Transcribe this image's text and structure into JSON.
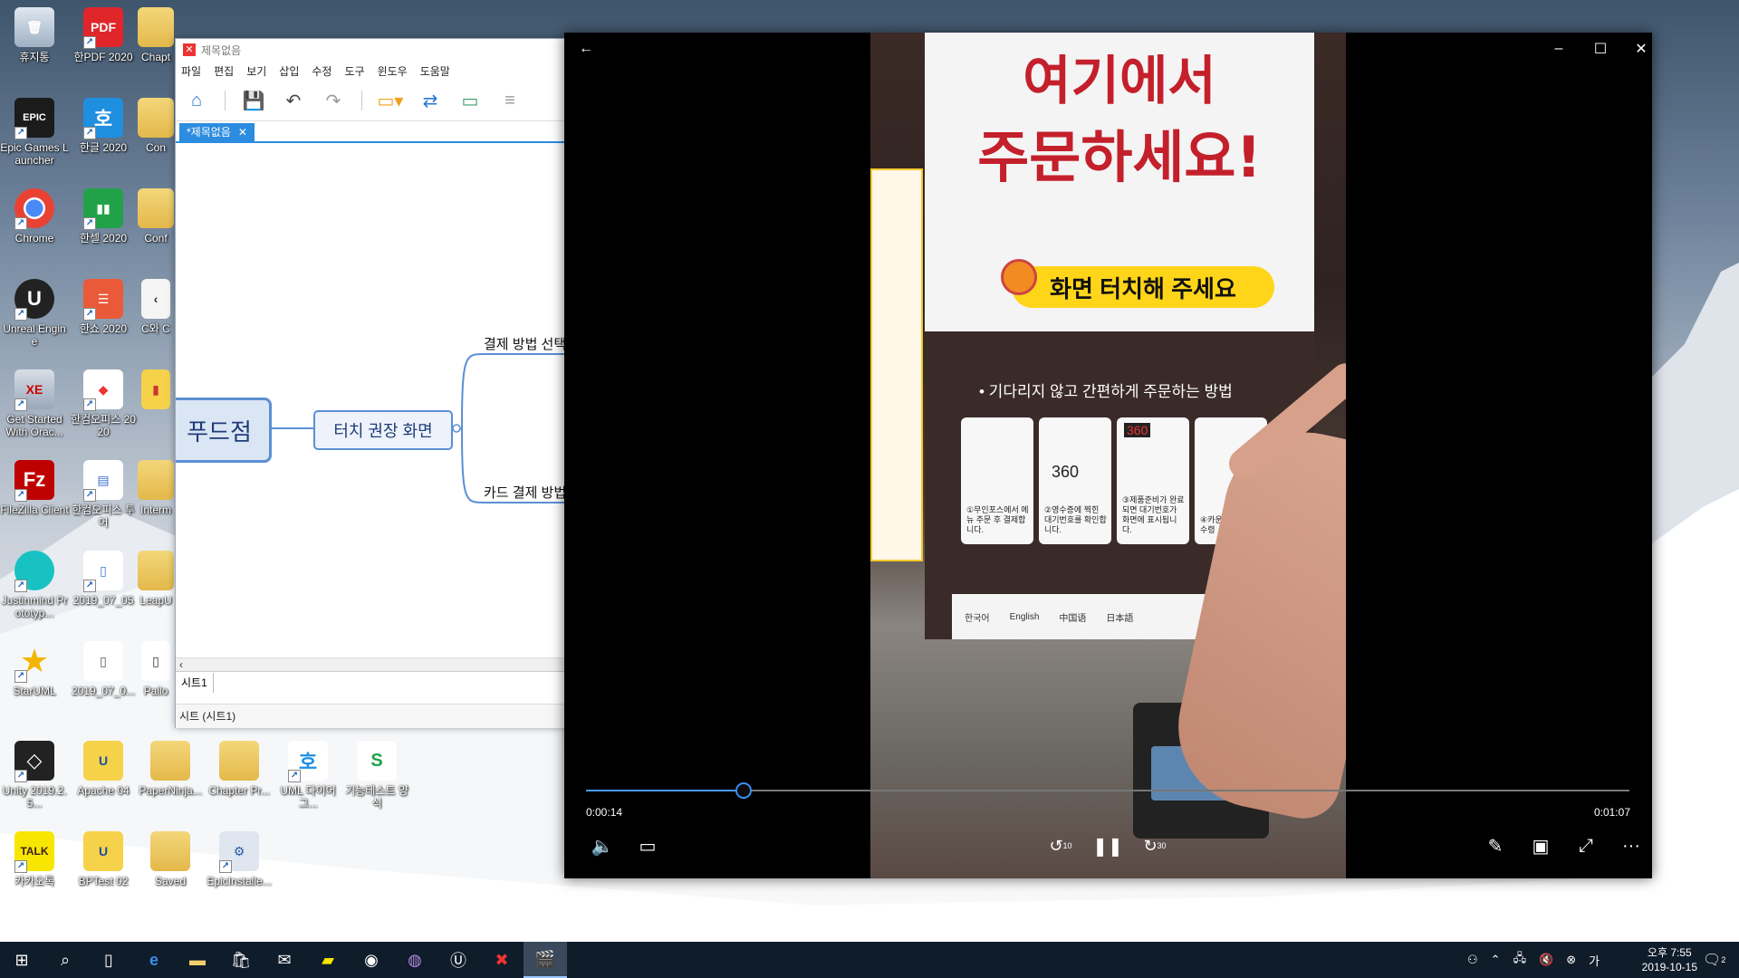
{
  "desktop": {
    "icons": [
      {
        "label": "휴지통",
        "type": "recycle"
      },
      {
        "label": "한PDF 2020",
        "type": "app"
      },
      {
        "label": "Chapt",
        "type": "folder"
      },
      {
        "label": "Epic Games Launcher",
        "type": "app"
      },
      {
        "label": "한글 2020",
        "type": "app"
      },
      {
        "label": "Con",
        "type": "folder"
      },
      {
        "label": "Chrome",
        "type": "app"
      },
      {
        "label": "한셀 2020",
        "type": "app"
      },
      {
        "label": "Conf",
        "type": "folder"
      },
      {
        "label": "Unreal Engine",
        "type": "app"
      },
      {
        "label": "한쇼 2020",
        "type": "app"
      },
      {
        "label": "C와 C",
        "type": "file"
      },
      {
        "label": "Get Started With Orac...",
        "type": "app"
      },
      {
        "label": "한컴오피스 2020",
        "type": "app"
      },
      {
        "label": "FileZilla Client",
        "type": "app"
      },
      {
        "label": "한컴오피스 투어",
        "type": "app"
      },
      {
        "label": "Interm",
        "type": "folder"
      },
      {
        "label": "Justinmind Prototyp...",
        "type": "app"
      },
      {
        "label": "2019_07_05",
        "type": "file"
      },
      {
        "label": "LeapU",
        "type": "folder"
      },
      {
        "label": "StarUML",
        "type": "app"
      },
      {
        "label": "2019_07_0...",
        "type": "file"
      },
      {
        "label": "Pallo",
        "type": "file"
      },
      {
        "label": "Unity 2019.2.5...",
        "type": "app"
      },
      {
        "label": "Apache 04",
        "type": "file"
      },
      {
        "label": "PaperNinja...",
        "type": "folder"
      },
      {
        "label": "Chapter Pr...",
        "type": "folder"
      },
      {
        "label": "UML 다이어그...",
        "type": "app"
      },
      {
        "label": "기능테스트 양식",
        "type": "file"
      },
      {
        "label": "카카오톡",
        "type": "app"
      },
      {
        "label": "BPTest 02",
        "type": "file"
      },
      {
        "label": "Saved",
        "type": "folder"
      },
      {
        "label": "EpicInstalle...",
        "type": "app"
      }
    ]
  },
  "xmind": {
    "title": "제목없음",
    "menu": [
      "파일",
      "편집",
      "보기",
      "삽입",
      "수정",
      "도구",
      "윈도우",
      "도움말"
    ],
    "tab_label": "*제목없음",
    "nodes": {
      "root": "푸드점",
      "main": "터치 권장 화면",
      "sub1": "결제 방법 선택",
      "sub2": "카드 결제 방법"
    },
    "sheet_tab": "시트1",
    "status": "시트 (시트1)"
  },
  "player": {
    "current_time": "0:00:14",
    "total_time": "0:01:07",
    "progress": 0.15,
    "skip_back": "10",
    "skip_forward": "30",
    "video": {
      "headline1": "여기에서",
      "headline2": "주문하세요!",
      "pill": "화면 터치해 주세요",
      "subline": "• 기다리지 않고 간편하게 주문하는 방법",
      "cards": [
        "①무인포스에서 메뉴 주문 후 결제합니다.",
        "②영수증에 찍힌 대기번호를 확인합니다.",
        "③제품준비가 완료되면 대기번호가 화면에 표시됩니다.",
        "④카운터 제품을 수령"
      ],
      "card_numbers": [
        "360",
        "360"
      ],
      "languages": [
        "한국어",
        "English",
        "中国语",
        "日本語"
      ]
    }
  },
  "taskbar": {
    "clock_time": "오후 7:55",
    "clock_date": "2019-10-15",
    "notification_count": "2"
  }
}
